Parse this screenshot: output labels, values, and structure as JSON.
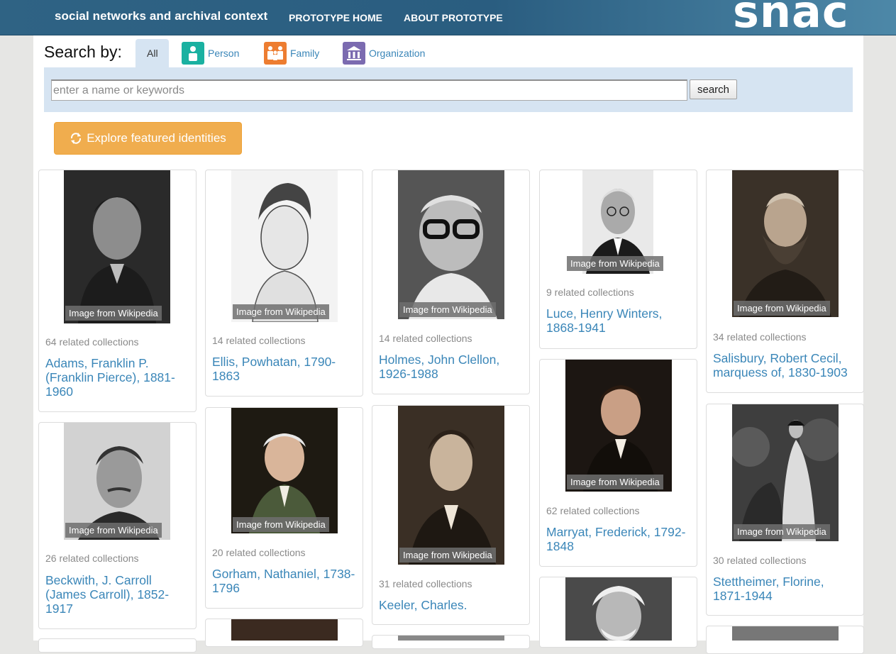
{
  "header": {
    "site_title": "social networks and archival context",
    "nav": [
      "PROTOTYPE HOME",
      "ABOUT PROTOTYPE"
    ],
    "logo_text": "snac"
  },
  "search": {
    "label": "Search by:",
    "tabs": [
      {
        "label": "All",
        "active": true
      },
      {
        "label": "Person",
        "icon": "person-icon",
        "color": "#1ab1a1"
      },
      {
        "label": "Family",
        "icon": "family-icon",
        "color": "#ed7d31"
      },
      {
        "label": "Organization",
        "icon": "organization-icon",
        "color": "#7b6bb0"
      }
    ],
    "placeholder": "enter a name or keywords",
    "button": "search"
  },
  "explore_button": "Explore featured identities",
  "badge_text": "Image from Wikipedia",
  "cards": [
    {
      "count": "64 related collections",
      "name": "Adams, Franklin P. (Franklin Pierce), 1881-1960"
    },
    {
      "count": "14 related collections",
      "name": "Ellis, Powhatan, 1790-1863"
    },
    {
      "count": "14 related collections",
      "name": "Holmes, John Clellon, 1926-1988"
    },
    {
      "count": "9 related collections",
      "name": "Luce, Henry Winters, 1868-1941"
    },
    {
      "count": "34 related collections",
      "name": "Salisbury, Robert Cecil, marquess of, 1830-1903"
    },
    {
      "count": "26 related collections",
      "name": "Beckwith, J. Carroll (James Carroll), 1852-1917"
    },
    {
      "count": "20 related collections",
      "name": "Gorham, Nathaniel, 1738-1796"
    },
    {
      "count": "31 related collections",
      "name": "Keeler, Charles."
    },
    {
      "count": "62 related collections",
      "name": "Marryat, Frederick, 1792-1848"
    },
    {
      "count": "30 related collections",
      "name": "Stettheimer, Florine, 1871-1944"
    }
  ]
}
